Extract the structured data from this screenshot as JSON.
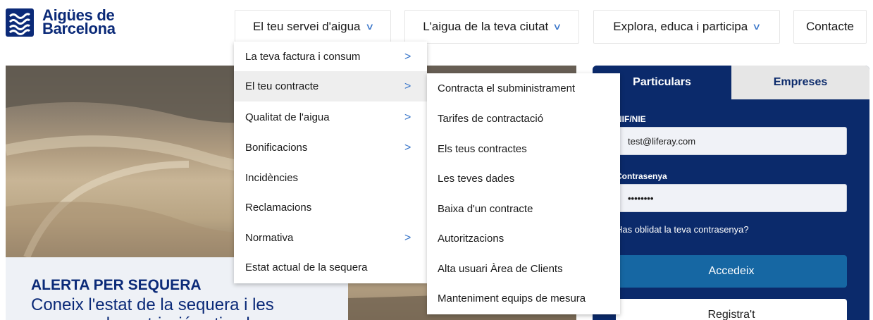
{
  "brand": {
    "line1": "Aigües de",
    "line2": "Barcelona",
    "color": "#0b2a78"
  },
  "nav": [
    {
      "label": "El teu servei d'aigua",
      "chevron": "chevron-down-icon"
    },
    {
      "label": "L'aigua de la teva ciutat",
      "chevron": "chevron-down-icon"
    },
    {
      "label": "Explora, educa i participa",
      "chevron": "chevron-down-icon"
    },
    {
      "label": "Contacte"
    }
  ],
  "menu": {
    "items": [
      {
        "label": "La teva factura i consum",
        "has_submenu": true
      },
      {
        "label": "El teu contracte",
        "has_submenu": true,
        "active": true
      },
      {
        "label": "Qualitat de l'aigua",
        "has_submenu": true
      },
      {
        "label": "Bonificacions",
        "has_submenu": true
      },
      {
        "label": "Incidències",
        "has_submenu": false
      },
      {
        "label": "Reclamacions",
        "has_submenu": false
      },
      {
        "label": "Normativa",
        "has_submenu": true
      },
      {
        "label": "Estat actual de la sequera",
        "has_submenu": false
      }
    ]
  },
  "submenu": {
    "items": [
      "Contracta el subministrament",
      "Tarifes de contractació",
      "Els teus contractes",
      "Les teves dades",
      "Baixa d'un contracte",
      "Autoritzacions",
      "Alta usuari Àrea de Clients",
      "Manteniment equips de mesura"
    ]
  },
  "hero": {
    "title": "ALERTA PER SEQUERA",
    "subtitle": "Coneix l'estat de la sequera i les mesures de restricció activades"
  },
  "login": {
    "tabs": [
      "Particulars",
      "Empreses"
    ],
    "nif_label": "NIF/NIE",
    "nif_value": "test@liferay.com",
    "password_label": "Contrasenya",
    "password_value": "••••••••",
    "forgot": "Has oblidat la teva contrasenya?",
    "submit": "Accedeix",
    "register": "Registra't"
  },
  "colors": {
    "accent": "#3a76c9",
    "panel": "#0b2a6b",
    "button": "#1667a3"
  }
}
